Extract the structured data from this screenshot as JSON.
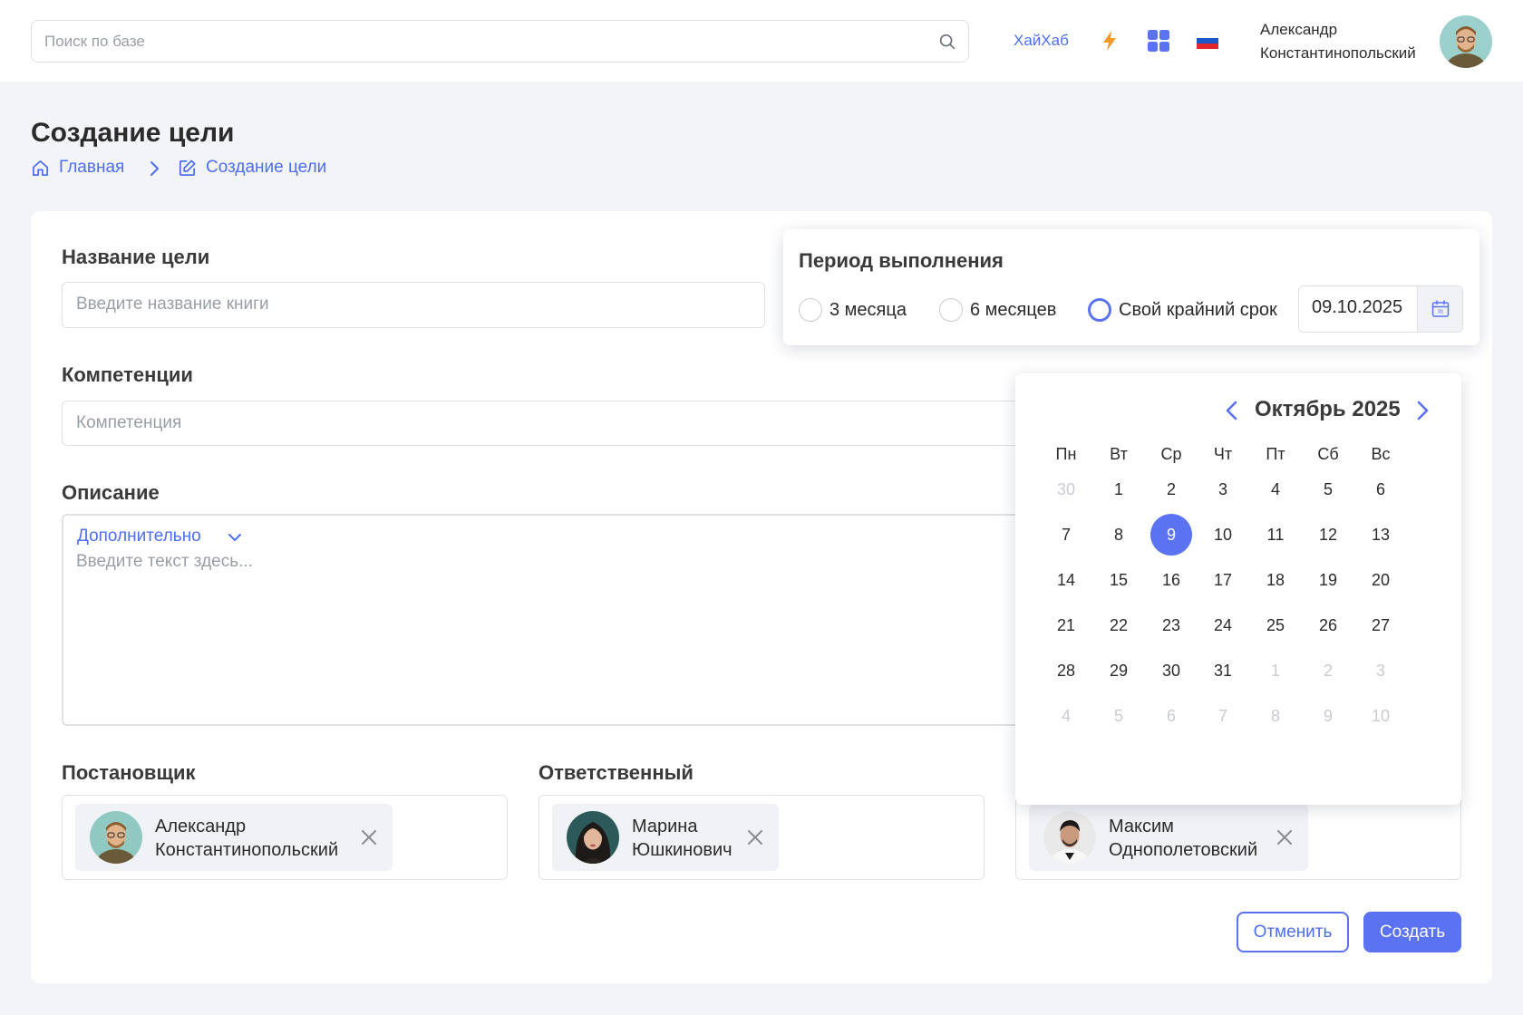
{
  "header": {
    "search_placeholder": "Поиск по базе",
    "hub_link": "ХайХаб",
    "user_line1": "Александр",
    "user_line2": "Константинопольский",
    "icons": [
      "search-icon",
      "lightning-icon",
      "apps-grid-icon",
      "russian-flag-icon",
      "user-avatar"
    ]
  },
  "page": {
    "title": "Создание цели",
    "breadcrumb": {
      "home": "Главная",
      "current": "Создание цели"
    }
  },
  "form": {
    "goal_label": "Название цели",
    "goal_placeholder": "Введите название книги",
    "competence_label": "Компетенции",
    "competence_placeholder": "Компетенция",
    "description_label": "Описание",
    "extra_toggle": "Дополнительно",
    "description_placeholder": "Введите текст здесь...",
    "assigner_label": "Постановщик",
    "responsible_label": "Ответственный",
    "assigner": {
      "line1": "Александр",
      "line2": "Константинопольский"
    },
    "responsible": {
      "line1": "Марина",
      "line2": "Юшкинович"
    },
    "third_person": {
      "line1": "Максим",
      "line2": "Однополетовский"
    },
    "cancel_button": "Отменить",
    "create_button": "Создать"
  },
  "period": {
    "title": "Период выполнения",
    "options": [
      "3 месяца",
      "6 месяцев",
      "Свой крайний срок"
    ],
    "selected_option": "Свой крайний срок",
    "date_value": "09.10.2025"
  },
  "calendar": {
    "month_title": "Октябрь 2025",
    "weekdays": [
      "Пн",
      "Вт",
      "Ср",
      "Чт",
      "Пт",
      "Сб",
      "Вс"
    ],
    "days": [
      "30",
      "1",
      "2",
      "3",
      "4",
      "5",
      "6",
      "7",
      "8",
      "9",
      "10",
      "11",
      "12",
      "13",
      "14",
      "15",
      "16",
      "17",
      "18",
      "19",
      "20",
      "21",
      "22",
      "23",
      "24",
      "25",
      "26",
      "27",
      "28",
      "29",
      "30",
      "31",
      "1",
      "2",
      "3",
      "4",
      "5",
      "6",
      "7",
      "8",
      "9",
      "10"
    ],
    "muted_days": [
      0,
      32,
      33,
      34,
      35,
      36,
      37,
      38,
      39,
      40,
      41
    ],
    "selected_day": 9,
    "accent_color": "#5b72f2"
  }
}
